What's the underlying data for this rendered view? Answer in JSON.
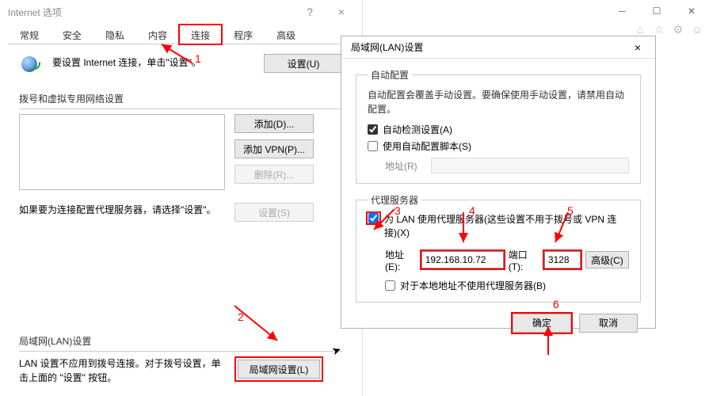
{
  "options_window": {
    "title": "Internet 选项",
    "help_tip": "?",
    "close_tip": "×",
    "tabs": [
      "常规",
      "安全",
      "隐私",
      "内容",
      "连接",
      "程序",
      "高级"
    ],
    "active_tab_index": 4,
    "internet_row_text": "要设置 Internet 连接，单击\"设置\"。",
    "btn_setup": "设置(U)",
    "dial_section_label": "拨号和虚拟专用网络设置",
    "btn_add": "添加(D)...",
    "btn_add_vpn": "添加 VPN(P)...",
    "btn_remove": "删除(R)...",
    "proxy_hint_text": "如果要为连接配置代理服务器，请选择\"设置\"。",
    "btn_settings": "设置(S)",
    "lan_section_label": "局域网(LAN)设置",
    "lan_hint_text": "LAN 设置不应用到拨号连接。对于拨号设置，单击上面的 \"设置\" 按钮。",
    "btn_lan": "局域网设置(L)"
  },
  "lan_dialog": {
    "title": "局域网(LAN)设置",
    "close": "×",
    "autocfg_legend": "自动配置",
    "autocfg_desc": "自动配置会覆盖手动设置。要确保使用手动设置，请禁用自动配置。",
    "chk_autodetect": "自动检测设置(A)",
    "chk_autoconfig": "使用自动配置脚本(S)",
    "url_label": "地址(R)",
    "proxy_legend": "代理服务器",
    "chk_useproxy": "为 LAN 使用代理服务器(这些设置不用于拨号或 VPN 连接)(X)",
    "addr_label": "地址(E):",
    "addr_value": "192.168.10.72",
    "port_label": "端口(T):",
    "port_value": "3128",
    "btn_advanced": "高级(C)",
    "chk_bypass": "对于本地地址不使用代理服务器(B)",
    "btn_ok": "确定",
    "btn_cancel": "取消"
  },
  "annotations": {
    "n1": "1",
    "n2": "2",
    "n3": "3",
    "n4": "4",
    "n5": "5",
    "n6": "6"
  }
}
